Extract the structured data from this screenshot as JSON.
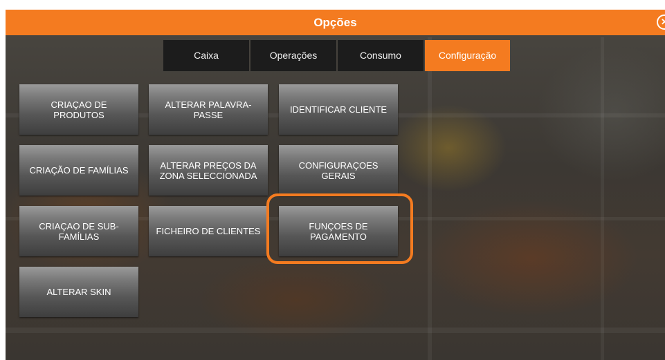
{
  "dialog": {
    "title": "Opções",
    "close_glyph": "✕",
    "accent_color": "#f47b20"
  },
  "tabs": [
    {
      "label": "Caixa",
      "active": false
    },
    {
      "label": "Operações",
      "active": false
    },
    {
      "label": "Consumo",
      "active": false
    },
    {
      "label": "Configuração",
      "active": true
    }
  ],
  "tiles": [
    {
      "label": "CRIAÇAO DE\nPRODUTOS"
    },
    {
      "label": "ALTERAR PALAVRA-\nPASSE"
    },
    {
      "label": "IDENTIFICAR CLIENTE"
    },
    {
      "label": "CRIAÇÃO DE FAMÍLIAS"
    },
    {
      "label": "ALTERAR PREÇOS DA\nZONA SELECCIONADA"
    },
    {
      "label": "CONFIGURAÇOES\nGERAIS"
    },
    {
      "label": "CRIAÇAO DE SUB-\nFAMÍLIAS"
    },
    {
      "label": "FICHEIRO DE CLIENTES"
    },
    {
      "label": "FUNÇOES DE\nPAGAMENTO"
    },
    {
      "label": "ALTERAR SKIN"
    }
  ]
}
